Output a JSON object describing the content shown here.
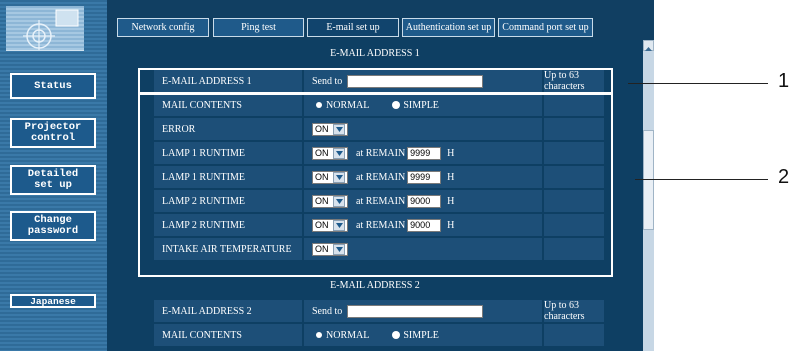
{
  "sidebar": {
    "buttons": [
      {
        "label": "Status"
      },
      {
        "label": "Projector\ncontrol"
      },
      {
        "label": "Detailed\nset up"
      },
      {
        "label": "Change\npassword"
      },
      {
        "label": "Japanese"
      }
    ]
  },
  "tabs": [
    {
      "label": "Network config"
    },
    {
      "label": "Ping test"
    },
    {
      "label": "E-mail set up"
    },
    {
      "label": "Authentication set up"
    },
    {
      "label": "Command port set up"
    }
  ],
  "section1": {
    "title": "E-MAIL ADDRESS 1",
    "address_label": "E-MAIL ADDRESS 1",
    "send_to": "Send to",
    "limit": "Up to 63 characters",
    "mail_contents": "MAIL CONTENTS",
    "normal": "NORMAL",
    "simple": "SIMPLE",
    "rows": [
      {
        "label": "ERROR",
        "select": "ON"
      },
      {
        "label": "LAMP 1 RUNTIME",
        "select": "ON",
        "remain_label": "at REMAIN",
        "value": "9999",
        "unit": "H"
      },
      {
        "label": "LAMP 1 RUNTIME",
        "select": "ON",
        "remain_label": "at REMAIN",
        "value": "9999",
        "unit": "H"
      },
      {
        "label": "LAMP 2 RUNTIME",
        "select": "ON",
        "remain_label": "at REMAIN",
        "value": "9000",
        "unit": "H"
      },
      {
        "label": "LAMP 2 RUNTIME",
        "select": "ON",
        "remain_label": "at REMAIN",
        "value": "9000",
        "unit": "H"
      },
      {
        "label": "INTAKE AIR TEMPERATURE",
        "select": "ON"
      }
    ]
  },
  "section2": {
    "title": "E-MAIL ADDRESS 2",
    "address_label": "E-MAIL ADDRESS 2",
    "send_to": "Send to",
    "limit": "Up to 63 characters",
    "mail_contents": "MAIL CONTENTS",
    "normal": "NORMAL",
    "simple": "SIMPLE"
  },
  "callouts": [
    "1",
    "2"
  ]
}
